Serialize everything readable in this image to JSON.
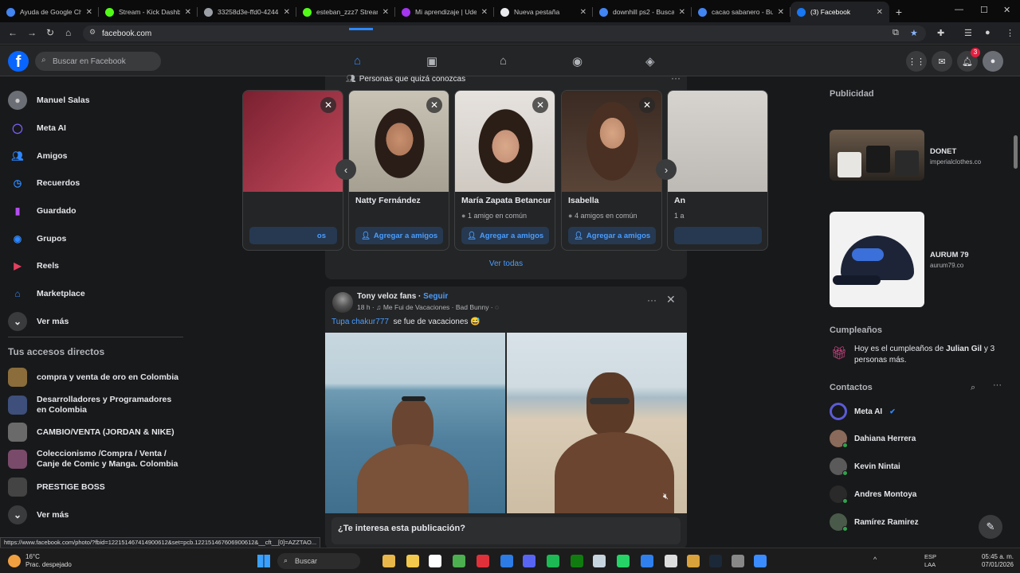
{
  "browser": {
    "tabs": [
      {
        "title": "Ayuda de Google Ch",
        "color": "#4285f4"
      },
      {
        "title": "Stream - Kick Dashbo",
        "color": "#53fc18"
      },
      {
        "title": "33258d3e-ffd0-4244",
        "color": "#9aa0a6"
      },
      {
        "title": "esteban_zzz7 Stream",
        "color": "#53fc18"
      },
      {
        "title": "Mi aprendizaje | Ude",
        "color": "#a435f0"
      },
      {
        "title": "Nueva pestaña",
        "color": "#e8eaed"
      },
      {
        "title": "downhill ps2 - Buscar",
        "color": "#4285f4"
      },
      {
        "title": "cacao sabanero - Bus",
        "color": "#4285f4"
      },
      {
        "title": "(3) Facebook",
        "color": "#1877f2"
      }
    ],
    "url": "facebook.com"
  },
  "fb": {
    "search_placeholder": "Buscar en Facebook",
    "notif_count": "3"
  },
  "left": {
    "items": [
      {
        "label": "Manuel Salas",
        "icon": "avatar"
      },
      {
        "label": "Meta AI",
        "icon": "meta-ai-icon"
      },
      {
        "label": "Amigos",
        "icon": "friends-icon"
      },
      {
        "label": "Recuerdos",
        "icon": "clock-icon"
      },
      {
        "label": "Guardado",
        "icon": "bookmark-icon"
      },
      {
        "label": "Grupos",
        "icon": "groups-icon"
      },
      {
        "label": "Reels",
        "icon": "reels-icon"
      },
      {
        "label": "Marketplace",
        "icon": "marketplace-icon"
      },
      {
        "label": "Ver más",
        "icon": "chevron-down-icon"
      }
    ],
    "shortcuts_title": "Tus accesos directos",
    "shortcuts": [
      {
        "label": "compra y venta de oro en Colombia",
        "color": "#8a6d3b"
      },
      {
        "label": "Desarrolladores y Programadores en Colombia",
        "color": "#3d4f7a"
      },
      {
        "label": "CAMBIO/VENTA (JORDAN & NIKE)",
        "color": "#6a6a6a"
      },
      {
        "label": "Coleccionismo /Compra / Venta / Canje de Comic y Manga. Colombia",
        "color": "#7a4a6a"
      },
      {
        "label": "PRESTIGE BOSS",
        "color": "#444"
      },
      {
        "label": "Ver más",
        "color": "#3a3b3c"
      }
    ]
  },
  "pymk": {
    "title": "Personas que quizá conozcas",
    "cards": [
      {
        "name": "Natty Fernández",
        "mutual": "",
        "add": "Agregar a amigos"
      },
      {
        "name": "María Zapata Betancur",
        "mutual": "1 amigo en común",
        "add": "Agregar a amigos"
      },
      {
        "name": "Isabella",
        "mutual": "4 amigos en común",
        "add": "Agregar a amigos"
      }
    ],
    "partial_left_add": "os",
    "partial_right_name": "An",
    "partial_right_mutual": "1 a",
    "see_all": "Ver todas"
  },
  "post": {
    "author": "Tony veloz fans",
    "follow": "Seguir",
    "meta": "18 h · ♫ Me Fui de Vacaciones · Bad Bunny · ◌",
    "tag": "Tupa chakur777",
    "text": "se fue de vacaciones 😅",
    "interest": "¿Te interesa esta publicación?"
  },
  "right": {
    "ads_title": "Publicidad",
    "ads": [
      {
        "name": "DONET",
        "url": "imperialclothes.co"
      },
      {
        "name": "AURUM 79",
        "url": "aurum79.co"
      }
    ],
    "birthday_title": "Cumpleaños",
    "birthday_pre": "Hoy es el cumpleaños de ",
    "birthday_name": "Julian Gil",
    "birthday_post": " y 3 personas más.",
    "contacts_title": "Contactos",
    "contacts": [
      {
        "name": "Meta AI",
        "color": "#5b5bd6"
      },
      {
        "name": "Dahiana Herrera",
        "color": "#8a6a5a"
      },
      {
        "name": "Kevin Nintai",
        "color": "#5a5a5a"
      },
      {
        "name": "Andres Montoya",
        "color": "#2a2a2a"
      },
      {
        "name": "Ramírez Ramirez",
        "color": "#4a5a4a"
      }
    ]
  },
  "status_url": "https://www.facebook.com/photo/?fbid=122151467414900612&set=pcb.122151467606900612&__cft__[0]=AZZTAO...",
  "taskbar": {
    "temp": "16°C",
    "weather": "Prac. despejado",
    "search": "Buscar",
    "lang1": "ESP",
    "lang2": "LAA",
    "time": "05:45 a. m.",
    "date": "07/01/2026"
  }
}
